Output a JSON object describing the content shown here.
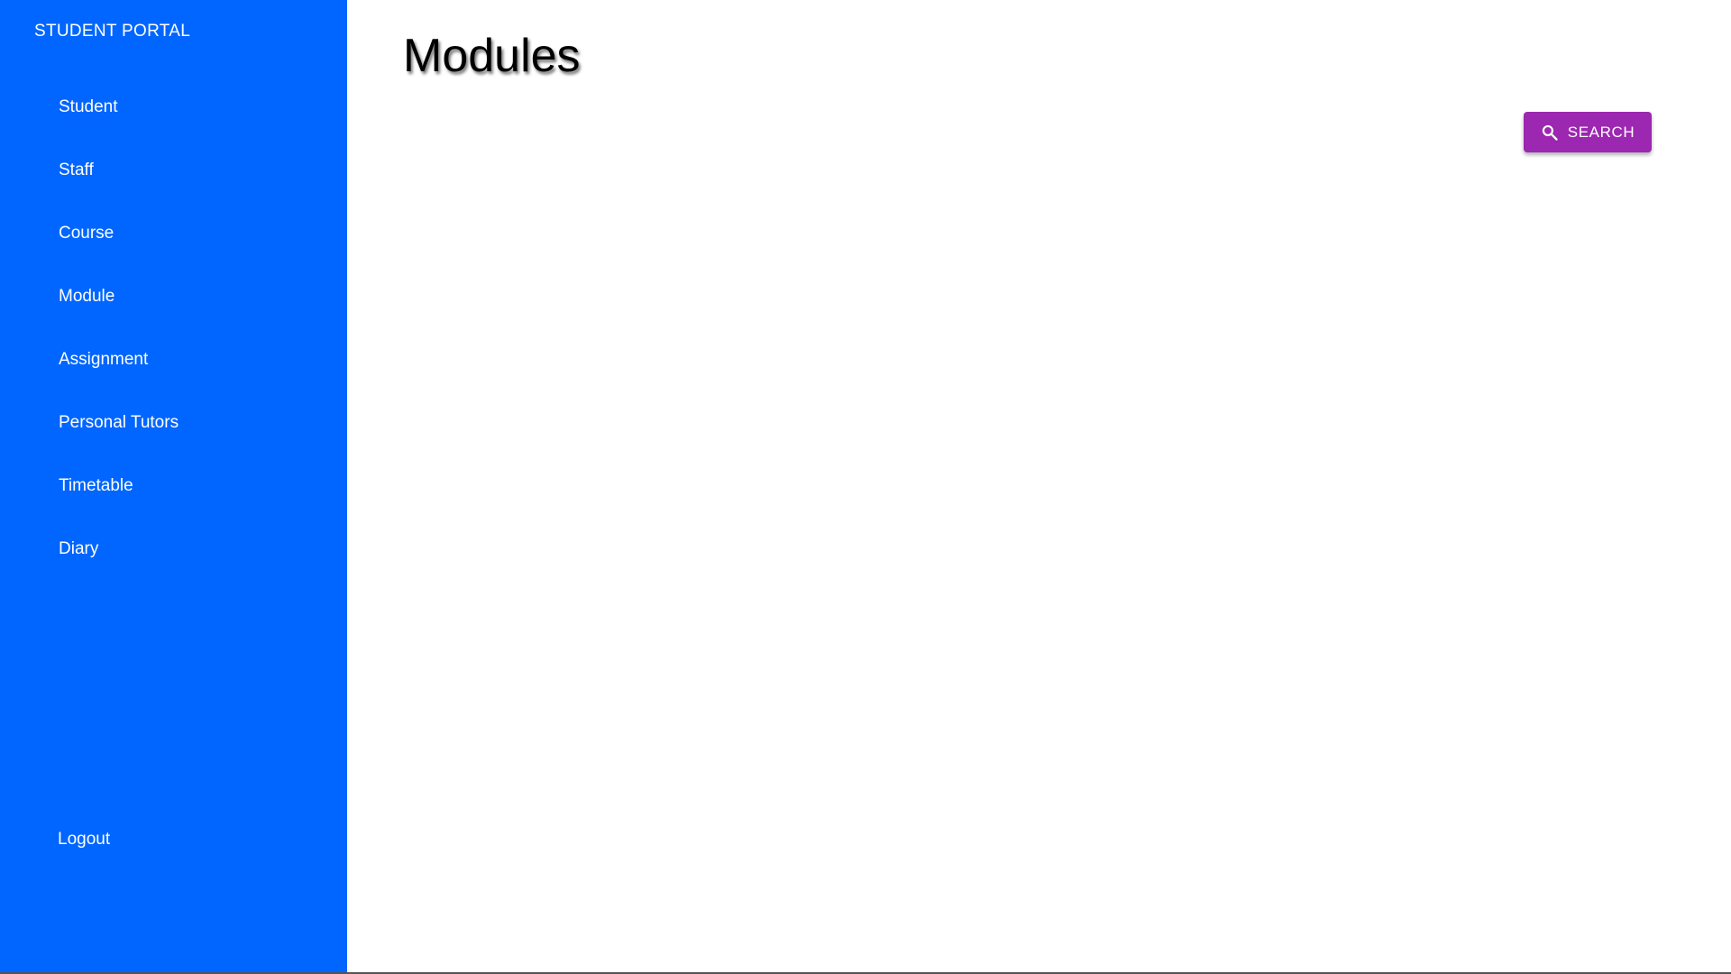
{
  "sidebar": {
    "brand": "STUDENT PORTAL",
    "items": [
      {
        "label": "Student"
      },
      {
        "label": "Staff"
      },
      {
        "label": "Course"
      },
      {
        "label": "Module"
      },
      {
        "label": "Assignment"
      },
      {
        "label": "Personal Tutors"
      },
      {
        "label": "Timetable"
      },
      {
        "label": "Diary"
      }
    ],
    "logout_label": "Logout"
  },
  "main": {
    "title": "Modules",
    "search_button": {
      "label": "SEARCH",
      "icon": "search-icon"
    }
  },
  "colors": {
    "sidebar_bg": "#0066ff",
    "search_button_bg": "#9c27b0",
    "text_light": "#ffffff"
  }
}
